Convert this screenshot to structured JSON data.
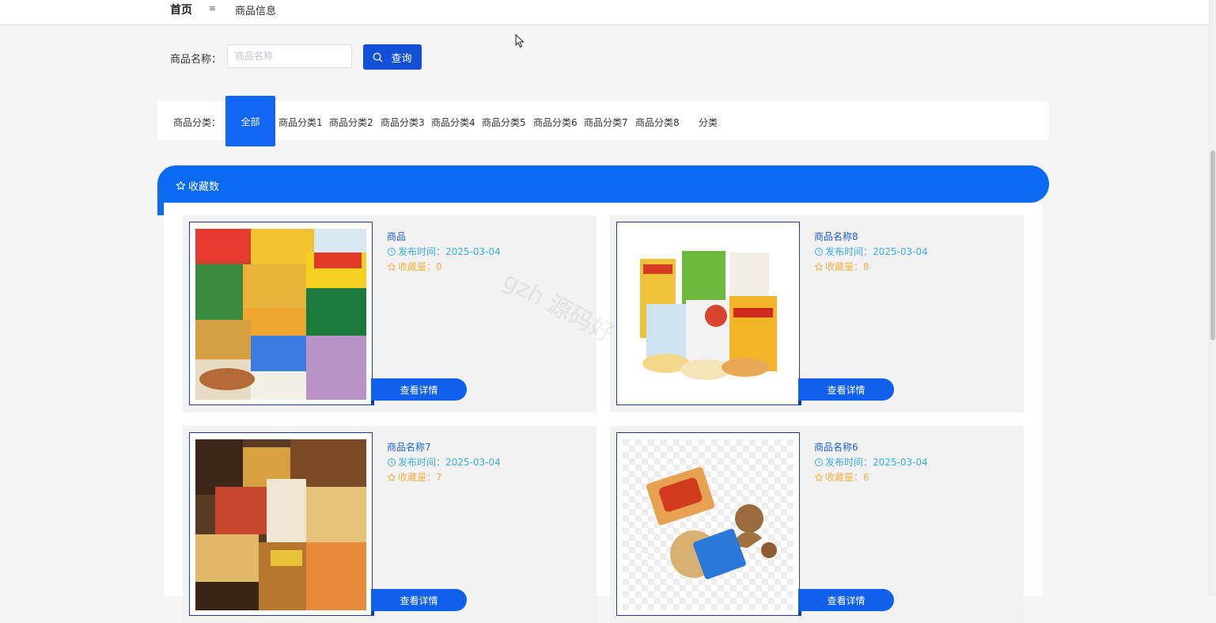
{
  "nav": {
    "home": "首页",
    "menu_icon": "≡",
    "breadcrumb": "商品信息"
  },
  "search": {
    "label": "商品名称：",
    "placeholder": "商品名称",
    "value": "",
    "button": "查询"
  },
  "categories": {
    "label": "商品分类：",
    "all": "全部",
    "items": [
      "商品分类1",
      "商品分类2",
      "商品分类3",
      "商品分类4",
      "商品分类5",
      "商品分类6",
      "商品分类7",
      "商品分类8",
      "分类"
    ]
  },
  "favorites": {
    "title": "收藏数"
  },
  "products": [
    {
      "name": "商品",
      "date": "发布时间：2025-03-04",
      "favorites": "收藏量：0",
      "detail": "查看详情"
    },
    {
      "name": "商品名称8",
      "date": "发布时间：2025-03-04",
      "favorites": "收藏量：8",
      "detail": "查看详情"
    },
    {
      "name": "商品名称7",
      "date": "发布时间：2025-03-04",
      "favorites": "收藏量：7",
      "detail": "查看详情"
    },
    {
      "name": "商品名称6",
      "date": "发布时间：2025-03-04",
      "favorites": "收藏量：6",
      "detail": "查看详情"
    }
  ],
  "watermark": "gzh 源码好",
  "colors": {
    "primary": "#0a6af2",
    "button": "#1250d8",
    "link": "#1a5fd0",
    "date": "#3aaeea",
    "favorites": "#f0b44a"
  }
}
